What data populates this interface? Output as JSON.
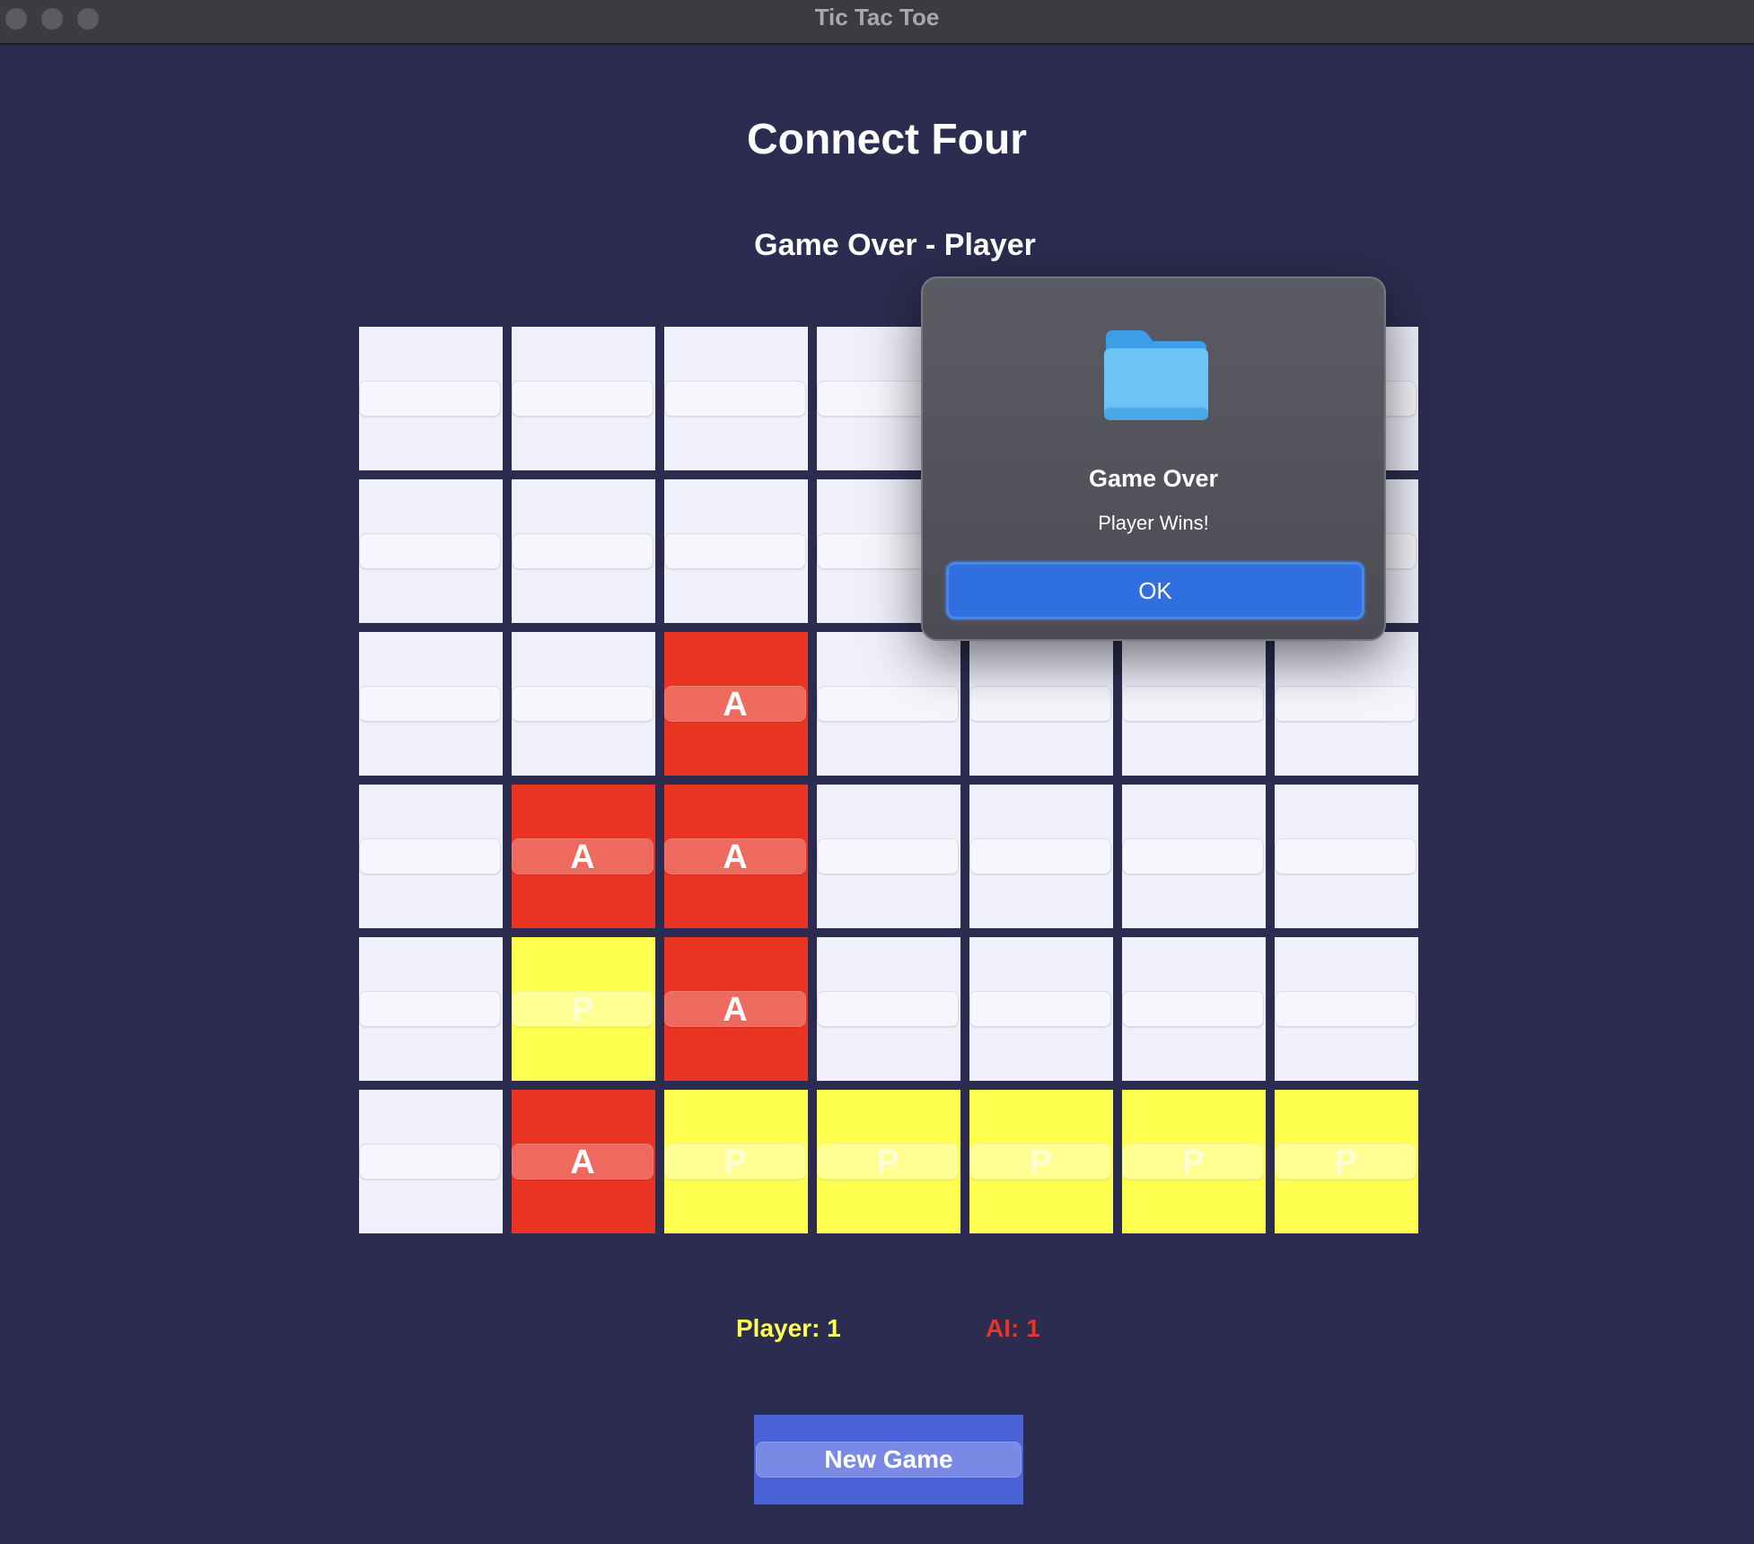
{
  "window": {
    "title": "Tic Tac Toe"
  },
  "app": {
    "title": "Connect Four",
    "status": "Game Over - Player"
  },
  "board": {
    "rows": [
      [
        "",
        "",
        "",
        "",
        "",
        "",
        ""
      ],
      [
        "",
        "",
        "",
        "",
        "",
        "",
        ""
      ],
      [
        "",
        "",
        "A",
        "",
        "",
        "",
        ""
      ],
      [
        "",
        "A",
        "A",
        "",
        "",
        "",
        ""
      ],
      [
        "",
        "P",
        "A",
        "",
        "",
        "",
        ""
      ],
      [
        "",
        "A",
        "P",
        "P",
        "P",
        "P",
        "P"
      ]
    ]
  },
  "scores": {
    "player": "Player: 1",
    "ai": "AI: 1"
  },
  "new_game_label": "New Game",
  "dialog": {
    "title": "Game Over",
    "message": "Player Wins!",
    "ok_label": "OK",
    "icon": "folder-icon"
  },
  "colors": {
    "background": "#2c2c50",
    "player": "#ffff50",
    "ai": "#e93323",
    "empty": "#f0f0fc",
    "accent": "#4b63d8"
  }
}
